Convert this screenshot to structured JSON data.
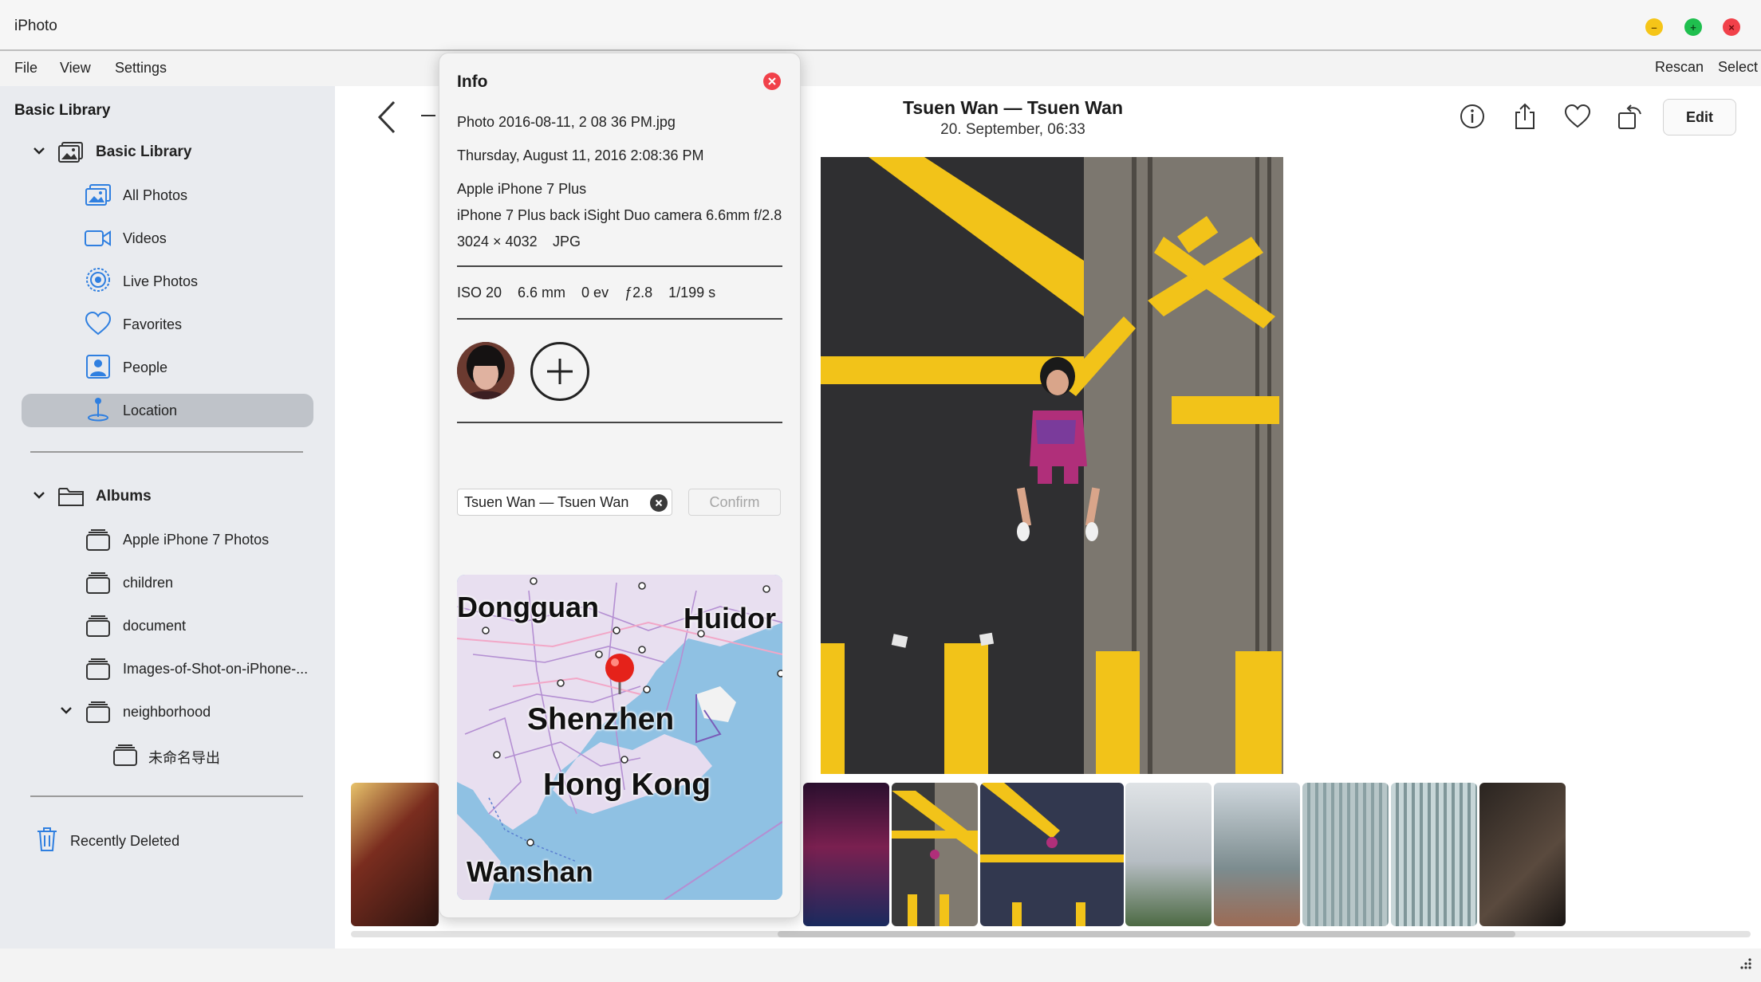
{
  "window": {
    "title": "iPhoto",
    "controls": {
      "minimize": "–",
      "maximize": "+",
      "close": "×"
    }
  },
  "menubar": {
    "file": "File",
    "view": "View",
    "settings": "Settings",
    "rescan": "Rescan",
    "select": "Select"
  },
  "sidebar": {
    "title": "Basic Library",
    "library_group": "Basic Library",
    "library_items": [
      {
        "label": "All Photos",
        "icon": "photos-icon"
      },
      {
        "label": "Videos",
        "icon": "video-icon"
      },
      {
        "label": "Live Photos",
        "icon": "live-photo-icon"
      },
      {
        "label": "Favorites",
        "icon": "heart-icon"
      },
      {
        "label": "People",
        "icon": "person-icon"
      },
      {
        "label": "Location",
        "icon": "location-pin-icon",
        "selected": true
      }
    ],
    "albums_group": "Albums",
    "albums": [
      {
        "label": "Apple iPhone 7 Photos"
      },
      {
        "label": "children"
      },
      {
        "label": "document"
      },
      {
        "label": "Images-of-Shot-on-iPhone-..."
      },
      {
        "label": "neighborhood",
        "expanded": true
      },
      {
        "label": "未命名导出",
        "child": true
      }
    ],
    "recently_deleted": "Recently Deleted"
  },
  "header": {
    "photo_title": "Tsuen Wan — Tsuen Wan",
    "photo_subtitle": "20. September, 06:33",
    "edit_label": "Edit"
  },
  "info": {
    "title": "Info",
    "filename": "Photo 2016-08-11, 2 08 36 PM.jpg",
    "datetime": "Thursday, August 11, 2016 2:08:36 PM",
    "camera": "Apple iPhone 7 Plus",
    "lens": "iPhone 7 Plus back iSight Duo camera 6.6mm f/2.8",
    "dimensions": "3024 × 4032",
    "format": "JPG",
    "exif": {
      "iso": "ISO 20",
      "focal": "6.6 mm",
      "ev": "0 ev",
      "aperture": "ƒ2.8",
      "shutter": "1/199 s"
    },
    "location_value": "Tsuen Wan — Tsuen Wan",
    "confirm_label": "Confirm",
    "map_labels": {
      "dongguan": "Dongguan",
      "huidong": "Huidor",
      "shenzhen": "Shenzhen",
      "hongkong": "Hong Kong",
      "wanshan": "Wanshan"
    }
  },
  "colors": {
    "accent_blue": "#2f7fe0",
    "selected_bg": "#bfc3c9",
    "close_red": "#f1414a",
    "minimize_yellow": "#f5c518",
    "maximize_green": "#1fbf4e",
    "road_yellow": "#f2c319",
    "map_water": "#8fc1e3",
    "pin_red": "#e5221a"
  }
}
